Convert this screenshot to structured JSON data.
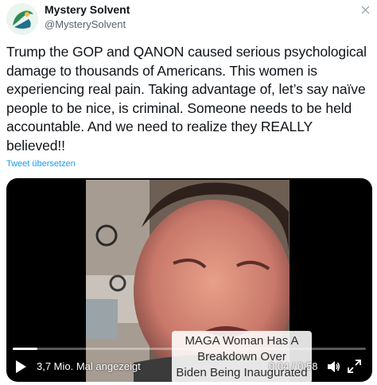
{
  "user": {
    "display_name": "Mystery Solvent",
    "handle": "@MysterySolvent"
  },
  "tweet": {
    "text": "Trump the GOP and QANON caused serious psychological damage to thousands of Americans. This women is experiencing real pain. Taking advantage of, let’s say naïve people to be nice, is criminal. Someone needs to be held accountable. And we need to realize they REALLY believed!!",
    "translate_label": "Tweet übersetzen"
  },
  "video": {
    "caption_lines": [
      "MAGA Woman Has A",
      "Breakdown Over",
      "Biden Being Inaugurated"
    ],
    "views_label": "3,7 Mio. Mal angezeigt",
    "time_label": "0:04 / 0:58",
    "progress_fraction": 0.07
  },
  "icons": {
    "close": "close-icon",
    "play": "play-icon",
    "volume": "volume-icon",
    "fullscreen": "fullscreen-icon",
    "avatar": "avatar-logo"
  },
  "colors": {
    "link": "#1d9bf0",
    "text": "#0f1419",
    "secondary": "#536471"
  }
}
